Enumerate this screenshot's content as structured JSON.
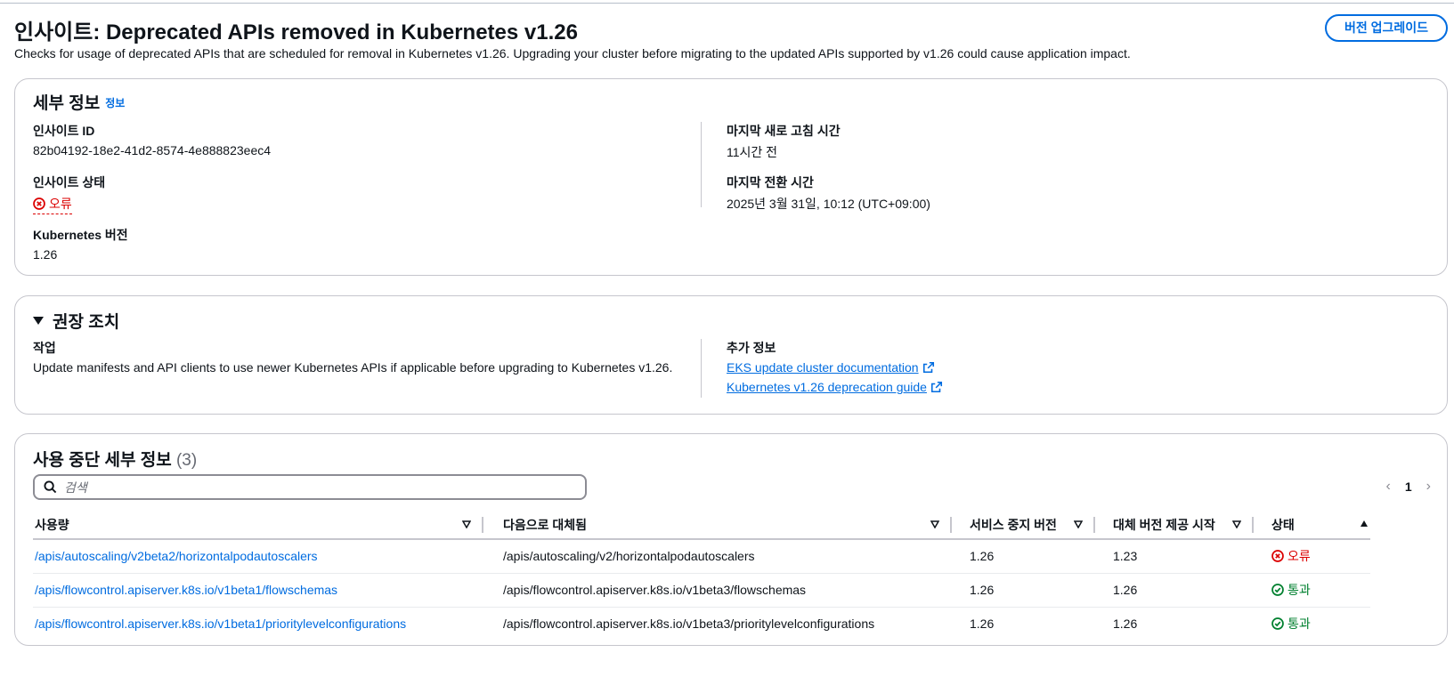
{
  "header": {
    "title": "인사이트: Deprecated APIs removed in Kubernetes v1.26",
    "description": "Checks for usage of deprecated APIs that are scheduled for removal in Kubernetes v1.26. Upgrading your cluster before migrating to the updated APIs supported by v1.26 could cause application impact.",
    "upgrade_button": "버전 업그레이드"
  },
  "details": {
    "title": "세부 정보",
    "info_link": "정보",
    "insight_id_label": "인사이트 ID",
    "insight_id_value": "82b04192-18e2-41d2-8574-4e888823eec4",
    "status_label": "인사이트 상태",
    "status_value": "오류",
    "k8s_version_label": "Kubernetes 버전",
    "k8s_version_value": "1.26",
    "last_refresh_label": "마지막 새로 고침 시간",
    "last_refresh_value": "11시간 전",
    "last_transition_label": "마지막 전환 시간",
    "last_transition_value": "2025년 3월 31일, 10:12 (UTC+09:00)"
  },
  "recommendation": {
    "title": "권장 조치",
    "task_label": "작업",
    "task_value": "Update manifests and API clients to use newer Kubernetes APIs if applicable before upgrading to Kubernetes v1.26.",
    "more_info_label": "추가 정보",
    "links": [
      "EKS update cluster documentation",
      "Kubernetes v1.26 deprecation guide"
    ]
  },
  "deprecations": {
    "title": "사용 중단 세부 정보",
    "count": "(3)",
    "search_placeholder": "검색",
    "page": "1",
    "columns": [
      "사용량",
      "다음으로 대체됨",
      "서비스 중지 버전",
      "대체 버전 제공 시작",
      "상태"
    ],
    "rows": [
      {
        "usage": "/apis/autoscaling/v2beta2/horizontalpodautoscalers",
        "replacement": "/apis/autoscaling/v2/horizontalpodautoscalers",
        "stop": "1.26",
        "start": "1.23",
        "status": "오류",
        "status_type": "error"
      },
      {
        "usage": "/apis/flowcontrol.apiserver.k8s.io/v1beta1/flowschemas",
        "replacement": "/apis/flowcontrol.apiserver.k8s.io/v1beta3/flowschemas",
        "stop": "1.26",
        "start": "1.26",
        "status": "통과",
        "status_type": "success"
      },
      {
        "usage": "/apis/flowcontrol.apiserver.k8s.io/v1beta1/prioritylevelconfigurations",
        "replacement": "/apis/flowcontrol.apiserver.k8s.io/v1beta3/prioritylevelconfigurations",
        "stop": "1.26",
        "start": "1.26",
        "status": "통과",
        "status_type": "success"
      }
    ]
  },
  "colors": {
    "link": "#006ce0",
    "error": "#db0000",
    "success": "#00802f",
    "border": "#c6c6cd"
  }
}
